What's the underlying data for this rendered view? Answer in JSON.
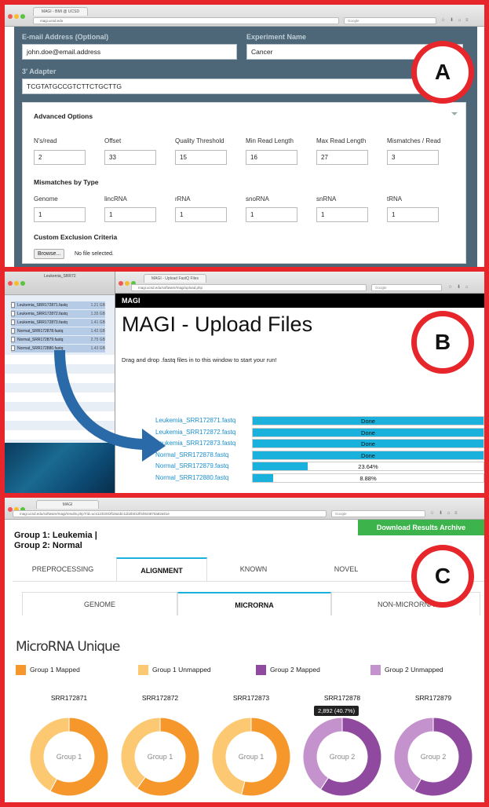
{
  "panel_a": {
    "tab_title": "MAGI - BMI @ UCSD",
    "url": "magi.ucsd.edu",
    "search_placeholder": "Google",
    "email_label": "E-mail Address (Optional)",
    "email_value": "john.doe@email.address",
    "experiment_label": "Experiment Name",
    "experiment_value": "Cancer",
    "adapter_label": "3' Adapter",
    "adapter_value": "TCGTATGCCGTCTTCTGCTTG",
    "advanced_title": "Advanced Options",
    "params": [
      {
        "label": "N's/read",
        "value": "2"
      },
      {
        "label": "Offset",
        "value": "33"
      },
      {
        "label": "Quality Threshold",
        "value": "15"
      },
      {
        "label": "Min Read Length",
        "value": "16"
      },
      {
        "label": "Max Read Length",
        "value": "27"
      },
      {
        "label": "Mismatches / Read",
        "value": "3"
      }
    ],
    "mismatch_title": "Mismatches by Type",
    "mismatch_types": [
      {
        "label": "Genome",
        "value": "1"
      },
      {
        "label": "lincRNA",
        "value": "1"
      },
      {
        "label": "rRNA",
        "value": "1"
      },
      {
        "label": "snoRNA",
        "value": "1"
      },
      {
        "label": "snRNA",
        "value": "1"
      },
      {
        "label": "tRNA",
        "value": "1"
      }
    ],
    "exclusion_title": "Custom Exclusion Criteria",
    "browse_label": "Browse...",
    "no_file": "No file selected.",
    "marker": "A"
  },
  "panel_b": {
    "finder_title": "Leukemia_SRR72",
    "files": [
      {
        "name": "Leukemia_SRR172871.fastq",
        "size": "1.21 GB"
      },
      {
        "name": "Leukemia_SRR172872.fastq",
        "size": "1.35 GB"
      },
      {
        "name": "Leukemia_SRR172873.fastq",
        "size": "1.41 GB"
      },
      {
        "name": "Normal_SRR172878.fastq",
        "size": "1.42 GB"
      },
      {
        "name": "Normal_SRR172879.fastq",
        "size": "2.75 GB"
      },
      {
        "name": "Normal_SRR172880.fastq",
        "size": "1.43 GB"
      }
    ],
    "tab_title": "MAGI - Upload FastQ Files",
    "url": "magi.ucsd.edu/software/magi/upload.php",
    "search_placeholder": "Google",
    "brand": "MAGI",
    "title": "MAGI - Upload Files",
    "subtitle": "Drag and drop .fastq files in to this window to start your run!",
    "uploads": [
      {
        "name": "Leukemia_SRR172871.fastq",
        "status": "Done",
        "progress": 1.0
      },
      {
        "name": "Leukemia_SRR172872.fastq",
        "status": "Done",
        "progress": 1.0
      },
      {
        "name": "Leukemia_SRR172873.fastq",
        "status": "Done",
        "progress": 1.0
      },
      {
        "name": "Normal_SRR172878.fastq",
        "status": "Done",
        "progress": 1.0
      },
      {
        "name": "Normal_SRR172879.fastq",
        "status": "23.64%",
        "progress": 0.2364
      },
      {
        "name": "Normal_SRR172880.fastq",
        "status": "8.88%",
        "progress": 0.0888
      }
    ],
    "marker": "B"
  },
  "panel_c": {
    "tab_title": "MAGI",
    "url": "magi.ucsd.edu/software/magi/results.php?rid=ucs1231003f18a1bc11b2b012f04944870a82a91e",
    "search_placeholder": "Google",
    "download_label": "Download Results Archive",
    "group_line1": "Group 1: Leukemia |",
    "group_line2": "Group 2: Normal",
    "tabs": [
      "PREPROCESSING",
      "ALIGNMENT",
      "KNOWN",
      "NOVEL"
    ],
    "active_tab": "ALIGNMENT",
    "subtabs": [
      "GENOME",
      "MICRORNA",
      "NON-MICRORNA"
    ],
    "active_subtab": "MICRORNA",
    "section_title": "MicroRNA Unique",
    "marker": "C",
    "colors": {
      "g1_mapped": "#f5972a",
      "g1_unmapped": "#fcc872",
      "g2_mapped": "#8f4aa0",
      "g2_unmapped": "#c492cd"
    }
  },
  "chart_data": {
    "type": "pie",
    "title": "MicroRNA Unique",
    "legend": [
      "Group 1 Mapped",
      "Group 1 Unmapped",
      "Group 2 Mapped",
      "Group 2 Unmapped"
    ],
    "samples": [
      {
        "name": "SRR172871",
        "group": "Group 1",
        "mapped_fraction": 0.58
      },
      {
        "name": "SRR172872",
        "group": "Group 1",
        "mapped_fraction": 0.6
      },
      {
        "name": "SRR172873",
        "group": "Group 1",
        "mapped_fraction": 0.54
      },
      {
        "name": "SRR172878",
        "group": "Group 2",
        "mapped_fraction": 0.593,
        "tooltip": "2,892 (40.7%)"
      },
      {
        "name": "SRR172879",
        "group": "Group 2",
        "mapped_fraction": 0.58
      }
    ]
  }
}
